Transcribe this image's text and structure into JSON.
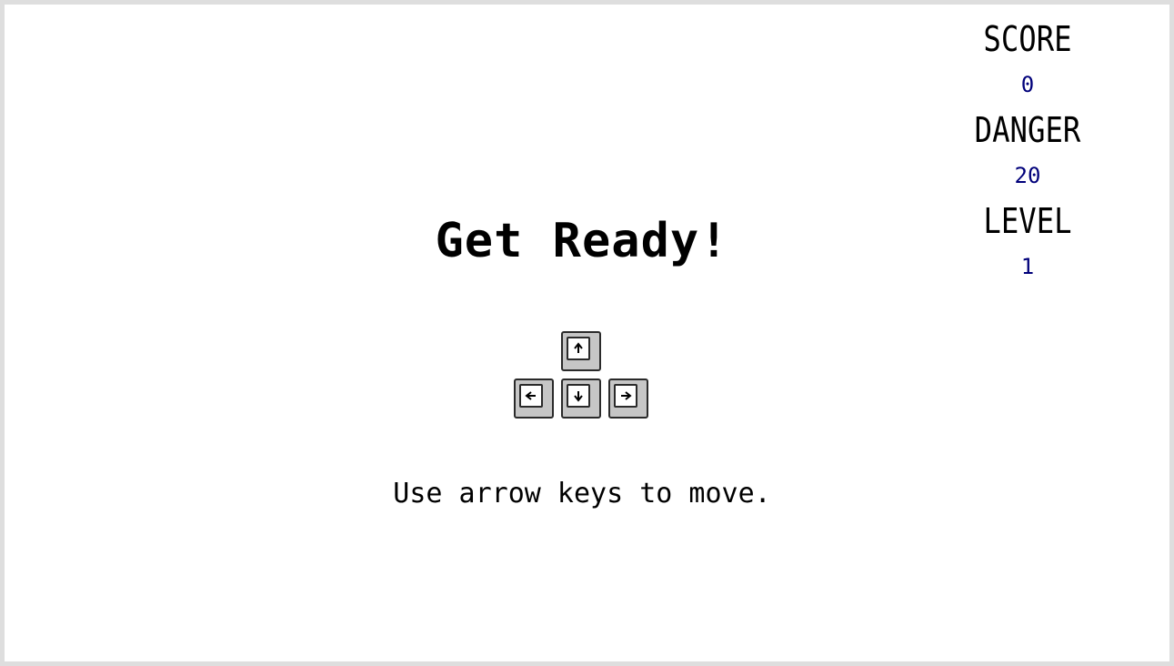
{
  "hud": {
    "score_label": "SCORE",
    "score_value": "0",
    "danger_label": "DANGER",
    "danger_value": "20",
    "level_label": "LEVEL",
    "level_value": "1"
  },
  "message": {
    "title": "Get Ready!",
    "hint": "Use arrow keys to move."
  },
  "keys": {
    "icons": [
      "arrow-up-icon",
      "arrow-left-icon",
      "arrow-down-icon",
      "arrow-right-icon"
    ]
  },
  "colors": {
    "label": "#000000",
    "value": "#00007a",
    "border": "#dedede",
    "key_fill": "#c6c6c6"
  }
}
